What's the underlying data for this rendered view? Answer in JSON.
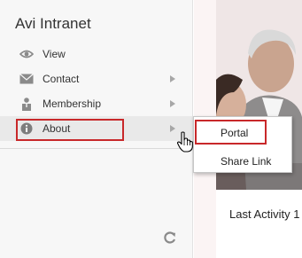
{
  "panel": {
    "title": "Avi Intranet",
    "items": [
      {
        "label": "View",
        "icon": "eye-icon",
        "has_submenu": false
      },
      {
        "label": "Contact",
        "icon": "envelope-icon",
        "has_submenu": true
      },
      {
        "label": "Membership",
        "icon": "person-icon",
        "has_submenu": true
      },
      {
        "label": "About",
        "icon": "info-icon",
        "has_submenu": true,
        "active": true
      }
    ],
    "refresh_icon": "refresh-icon"
  },
  "submenu": {
    "items": [
      {
        "label": "Portal",
        "highlighted": true
      },
      {
        "label": "Share Link"
      }
    ]
  },
  "content": {
    "last_activity": "Last Activity 1"
  },
  "colors": {
    "highlight_outline": "#c8282a",
    "panel_bg": "#f7f7f7",
    "icon_gray": "#8a8a8a",
    "arrow_gray": "#a7a7a7"
  }
}
